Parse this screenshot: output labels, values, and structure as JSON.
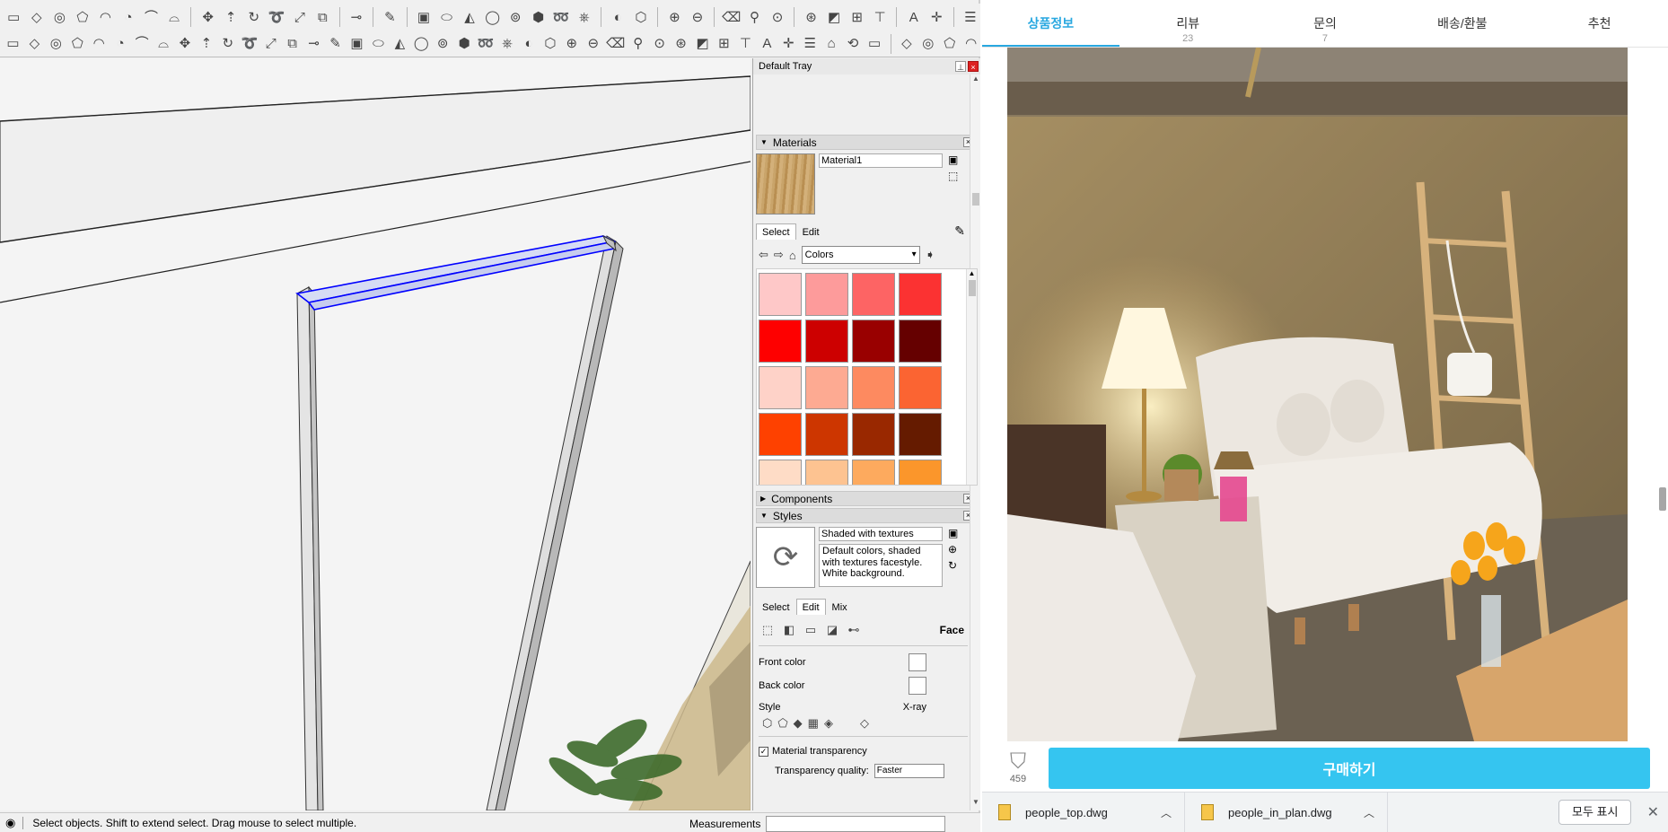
{
  "sketchup": {
    "toolbar_row1_icons": [
      "rectangle-icon",
      "rotated-rect-icon",
      "circle-icon",
      "polygon-icon",
      "arc-icon",
      "pie-icon",
      "arc2-icon",
      "3pt-arc-icon",
      "sep",
      "move-icon",
      "pushpull-icon",
      "rotate-icon",
      "followme-icon",
      "scale-icon",
      "offset-icon",
      "sep",
      "tape-icon",
      "sep",
      "paint-icon",
      "sep",
      "box-icon",
      "cylinder-icon",
      "cone-icon",
      "torus-icon",
      "tube-icon",
      "prism-icon",
      "helix-icon",
      "lathe-icon",
      "sep",
      "shape-icon",
      "solid-icon",
      "sep",
      "intersect-icon",
      "eraser-icon",
      "sep",
      "walk-icon",
      "position-camera-icon",
      "look-around-icon",
      "sep",
      "section-icon",
      "dimension-icon",
      "text-icon",
      "axes-icon",
      "sep",
      "layer-icon",
      "warehouse-icon",
      "sep",
      "orbit-icon"
    ],
    "toolbar_row2_icons": [
      "tool-a",
      "tool-b",
      "tool-c",
      "tool-d",
      "tool-e",
      "tool-f",
      "tool-g",
      "tool-h",
      "tool-i",
      "tool-j",
      "tool-k",
      "tool-l",
      "tool-m",
      "tool-n",
      "tool-o",
      "tool-p",
      "tool-q",
      "tool-r",
      "tool-s",
      "tool-t",
      "tool-u",
      "tool-v",
      "tool-w",
      "tool-x",
      "tool-y",
      "tool-z",
      "tool-aa",
      "tool-ab",
      "tool-ac",
      "tool-ad",
      "tool-ae",
      "tool-af",
      "tool-ag",
      "tool-ah",
      "tool-ai",
      "tool-aj",
      "tool-ak",
      "tool-al",
      "tool-am",
      "tool-an",
      "tool-ao",
      "sep",
      "tool-ap",
      "tool-aq",
      "tool-ar",
      "tool-as"
    ],
    "tray": {
      "title": "Default Tray",
      "materials": {
        "heading": "Materials",
        "material_name": "Material1",
        "tab_select": "Select",
        "tab_edit": "Edit",
        "library": "Colors",
        "colors": [
          "#fec8c8",
          "#fd9b9b",
          "#fd6464",
          "#fb3232",
          "#fe0000",
          "#cd0000",
          "#990000",
          "#650000",
          "#fed2c8",
          "#fdaa92",
          "#fd8a60",
          "#fb6432",
          "#fe4100",
          "#cd3600",
          "#992800",
          "#651b00",
          "#fedcc6",
          "#fdc391",
          "#fdaa5e",
          "#fb962b"
        ]
      },
      "components": {
        "heading": "Components"
      },
      "styles": {
        "heading": "Styles",
        "style_name": "Shaded with textures",
        "style_desc": "Default colors, shaded with textures facestyle. White background.",
        "tab_select": "Select",
        "tab_edit": "Edit",
        "tab_mix": "Mix",
        "face_label": "Face",
        "front_color": "Front color",
        "back_color": "Back color",
        "style_label": "Style",
        "xray_label": "X-ray",
        "material_transparency": "Material transparency",
        "transparency_quality": "Transparency quality:",
        "transparency_value": "Faster"
      }
    },
    "status_text": "Select objects. Shift to extend select. Drag mouse to select multiple.",
    "measurements_label": "Measurements"
  },
  "shop": {
    "tabs": [
      {
        "label": "상품정보",
        "count": ""
      },
      {
        "label": "리뷰",
        "count": "23"
      },
      {
        "label": "문의",
        "count": "7"
      },
      {
        "label": "배송/환불",
        "count": ""
      },
      {
        "label": "추천",
        "count": ""
      }
    ],
    "wish_count": "459",
    "buy_label": "구매하기"
  },
  "downloads": {
    "items": [
      {
        "name": "people_top.dwg"
      },
      {
        "name": "people_in_plan.dwg"
      }
    ],
    "show_all": "모두 표시"
  },
  "colors": {
    "accent": "#35c5f0",
    "tab_active": "#29a8e0",
    "selection_blue": "#0000ff"
  }
}
